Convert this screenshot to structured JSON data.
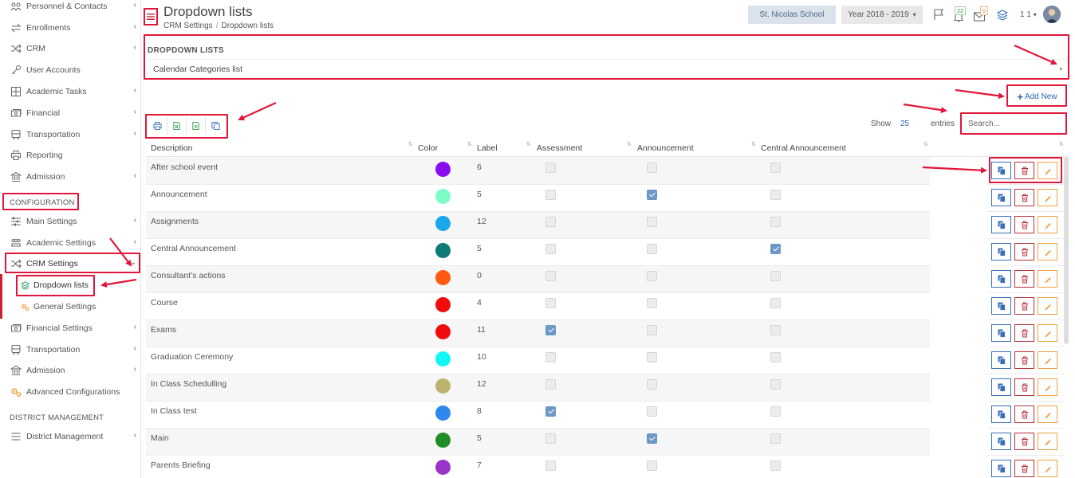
{
  "sidebar": {
    "items": [
      {
        "label": "Personnel & Contacts",
        "icon": "contacts-icon",
        "chevron": "‹"
      },
      {
        "label": "Enrollments",
        "icon": "arrows-exchange-icon",
        "chevron": "‹"
      },
      {
        "label": "CRM",
        "icon": "shuffle-icon",
        "chevron": "‹"
      },
      {
        "label": "User Accounts",
        "icon": "key-icon",
        "chevron": ""
      },
      {
        "label": "Academic Tasks",
        "icon": "grid-icon",
        "chevron": "‹"
      },
      {
        "label": "Financial",
        "icon": "money-icon",
        "chevron": "‹"
      },
      {
        "label": "Transportation",
        "icon": "bus-icon",
        "chevron": "‹"
      },
      {
        "label": "Reporting",
        "icon": "printer-icon",
        "chevron": ""
      },
      {
        "label": "Admission",
        "icon": "bank-icon",
        "chevron": "‹"
      }
    ],
    "section_configuration": "CONFIGURATION",
    "config_items": [
      {
        "label": "Main Settings",
        "icon": "sliders-icon",
        "chevron": "‹"
      },
      {
        "label": "Academic Settings",
        "icon": "group-icon",
        "chevron": "‹"
      },
      {
        "label": "CRM Settings",
        "icon": "shuffle-icon",
        "chevron": "⌄"
      }
    ],
    "sub_items": [
      {
        "label": "Dropdown lists",
        "icon": "layers-icon"
      },
      {
        "label": "General Settings",
        "icon": "gears-icon"
      }
    ],
    "config_items_after": [
      {
        "label": "Financial Settings",
        "icon": "money-icon",
        "chevron": "‹"
      },
      {
        "label": "Transportation",
        "icon": "bus-icon",
        "chevron": "‹"
      },
      {
        "label": "Admission",
        "icon": "bank-icon",
        "chevron": "‹"
      },
      {
        "label": "Advanced Configurations",
        "icon": "gears-icon",
        "chevron": ""
      }
    ],
    "section_district": "DISTRICT MANAGEMENT",
    "district_items": [
      {
        "label": "District Management",
        "icon": "menu-lines-icon",
        "chevron": "‹"
      }
    ]
  },
  "header": {
    "title": "Dropdown lists",
    "breadcrumb": [
      "CRM Settings",
      "Dropdown lists"
    ],
    "breadcrumb_sep": "/",
    "school": "St. Nicolas School",
    "year": "Year 2018 - 2019",
    "year_caret": "▾",
    "notif_count": "22",
    "mail_count": "0",
    "user_number": "1 1",
    "user_caret": "▾"
  },
  "dropdown": {
    "label": "DROPDOWN LISTS",
    "selected": "Calendar Categories list",
    "caret": "▾"
  },
  "add_new": {
    "plus": "+",
    "label": "Add New"
  },
  "length_control": {
    "show": "Show",
    "value": "25",
    "entries": "entries"
  },
  "search": {
    "placeholder": "Search..."
  },
  "table": {
    "columns": [
      "Description",
      "Color",
      "Label",
      "Assessment",
      "Announcement",
      "Central Announcement"
    ],
    "rows": [
      {
        "description": "After school event",
        "color": "#8a0df0",
        "label": "6",
        "assessment": false,
        "announcement": false,
        "central": false
      },
      {
        "description": "Announcement",
        "color": "#7dfcc8",
        "label": "5",
        "assessment": false,
        "announcement": true,
        "central": false
      },
      {
        "description": "Assignments",
        "color": "#1aa8e8",
        "label": "12",
        "assessment": false,
        "announcement": false,
        "central": false
      },
      {
        "description": "Central Announcement",
        "color": "#0f7a78",
        "label": "5",
        "assessment": false,
        "announcement": false,
        "central": true
      },
      {
        "description": "Consultant's actions",
        "color": "#ff5a12",
        "label": "0",
        "assessment": false,
        "announcement": false,
        "central": false
      },
      {
        "description": "Course",
        "color": "#f20d0d",
        "label": "4",
        "assessment": false,
        "announcement": false,
        "central": false
      },
      {
        "description": "Exams",
        "color": "#f00c0c",
        "label": "11",
        "assessment": true,
        "announcement": false,
        "central": false
      },
      {
        "description": "Graduation Ceremony",
        "color": "#12f6f6",
        "label": "10",
        "assessment": false,
        "announcement": false,
        "central": false
      },
      {
        "description": "In Class Schedulling",
        "color": "#bcb46e",
        "label": "12",
        "assessment": false,
        "announcement": false,
        "central": false
      },
      {
        "description": "In Class test",
        "color": "#2e88ee",
        "label": "8",
        "assessment": true,
        "announcement": false,
        "central": false
      },
      {
        "description": "Main",
        "color": "#1e8e26",
        "label": "5",
        "assessment": false,
        "announcement": true,
        "central": false
      },
      {
        "description": "Parents Briefing",
        "color": "#9a35cc",
        "label": "7",
        "assessment": false,
        "announcement": false,
        "central": false
      }
    ]
  },
  "colors": {
    "accent_red": "#e0173a",
    "link_blue": "#2a62b0",
    "check_blue": "#6b98c7"
  }
}
